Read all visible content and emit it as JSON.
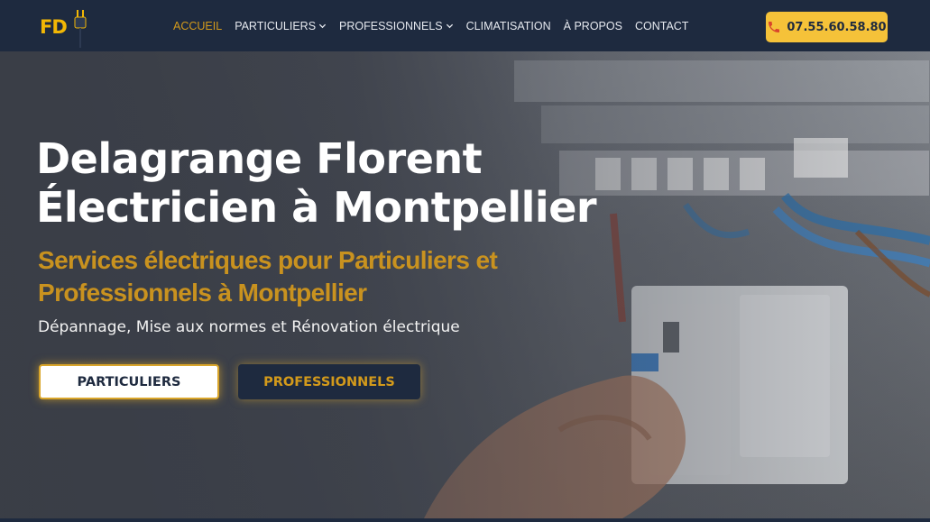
{
  "brand": {
    "logo_text": "FD",
    "logo_icon": "plug-icon",
    "accent": "#f2b705",
    "navy": "#1e2a3f"
  },
  "nav": {
    "items": [
      {
        "label": "ACCUEIL",
        "active": true
      },
      {
        "label": "PARTICULIERS",
        "dropdown": true
      },
      {
        "label": "PROFESSIONNELS",
        "dropdown": true
      },
      {
        "label": "CLIMATISATION"
      },
      {
        "label": "À PROPOS"
      },
      {
        "label": "CONTACT"
      }
    ]
  },
  "phone": {
    "number": "07.55.60.58.80",
    "icon": "phone-icon"
  },
  "hero": {
    "title_line1": "Delagrange Florent",
    "title_line2": "Électricien à Montpellier",
    "subtitle_line1": "Services électriques pour Particuliers et",
    "subtitle_line2": "Professionnels à Montpellier",
    "description": "Dépannage, Mise aux normes et Rénovation électrique",
    "btn_particuliers": "PARTICULIERS",
    "btn_professionnels": "PROFESSIONNELS"
  }
}
